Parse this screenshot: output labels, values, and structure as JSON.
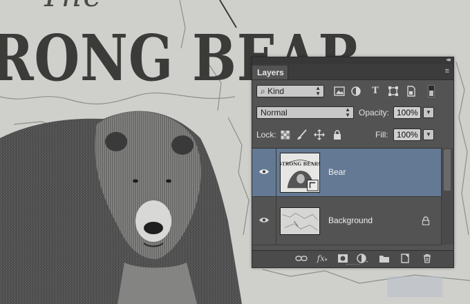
{
  "artwork": {
    "title_small": "The",
    "title_big": "RONG BEAR"
  },
  "panel": {
    "tab_label": "Layers",
    "collapse_glyph": "◂◂",
    "menu_glyph": "≡",
    "filter": {
      "label": "Kind",
      "search_glyph": "⌕",
      "icons": [
        "image-filter-icon",
        "adjustment-filter-icon",
        "type-filter-icon",
        "shape-filter-icon",
        "smart-object-filter-icon",
        "filter-toggle-icon"
      ]
    },
    "blend_mode": "Normal",
    "opacity_label": "Opacity:",
    "opacity_value": "100%",
    "lock_label": "Lock:",
    "fill_label": "Fill:",
    "fill_value": "100%",
    "layers": [
      {
        "name": "Bear",
        "selected": true,
        "thumb_text": "STRONG BEARS"
      },
      {
        "name": "Background",
        "selected": false,
        "locked": true
      }
    ],
    "bottom_icons": [
      "link-layers-icon",
      "fx-icon",
      "add-mask-icon",
      "new-adjustment-icon",
      "new-group-icon",
      "new-layer-icon",
      "trash-icon"
    ],
    "fx_label": "fx",
    "colors": {
      "selected_row": "#647a94",
      "panel_bg": "#535353"
    }
  }
}
